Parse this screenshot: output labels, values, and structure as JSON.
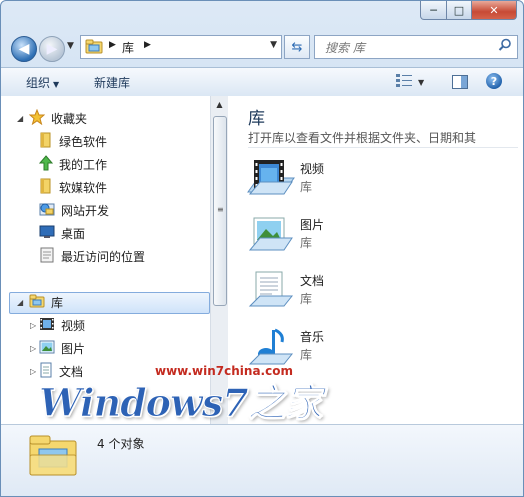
{
  "window": {
    "caption": {
      "minimize": "─",
      "maximize": "□",
      "close": "✕"
    }
  },
  "nav": {
    "back_glyph": "◀",
    "forward_glyph": "▶",
    "breadcrumb": [
      "库"
    ],
    "search_placeholder": "搜索 库"
  },
  "toolbar": {
    "organize": "组织",
    "new_library": "新建库",
    "help": "?"
  },
  "sidebar": {
    "favorites": {
      "label": "收藏夹",
      "icon": "star-icon"
    },
    "favorite_items": [
      {
        "label": "绿色软件",
        "icon": "folder-icon"
      },
      {
        "label": "我的工作",
        "icon": "green-arrow-icon"
      },
      {
        "label": "软媒软件",
        "icon": "folder-icon"
      },
      {
        "label": "网站开发",
        "icon": "web-icon"
      },
      {
        "label": "桌面",
        "icon": "desktop-icon"
      },
      {
        "label": "最近访问的位置",
        "icon": "recent-icon"
      }
    ],
    "libraries": {
      "label": "库",
      "icon": "library-icon"
    },
    "library_items": [
      {
        "label": "视频",
        "icon": "video-icon"
      },
      {
        "label": "图片",
        "icon": "pictures-icon"
      },
      {
        "label": "文档",
        "icon": "documents-icon"
      }
    ]
  },
  "content": {
    "title": "库",
    "subtitle": "打开库以查看文件并根据文件夹、日期和其",
    "items": [
      {
        "name": "视频",
        "kind": "库"
      },
      {
        "name": "图片",
        "kind": "库"
      },
      {
        "name": "文档",
        "kind": "库"
      },
      {
        "name": "音乐",
        "kind": "库"
      }
    ]
  },
  "details": {
    "count": "4 个对象"
  },
  "watermark": {
    "url": "www.win7china.com",
    "text": "Windows7之家"
  }
}
